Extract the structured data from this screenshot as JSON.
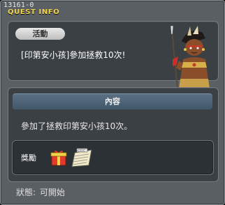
{
  "window": {
    "quest_id": "13161-0",
    "title": "QUEST INFO"
  },
  "summary": {
    "activity_badge": "活動",
    "quest_name": "[印第安小孩]參加拯救10次!"
  },
  "content": {
    "header": "內容",
    "description": "參加了拯救印第安小孩10次。",
    "reward_label": "獎勵",
    "reward_icons": [
      "gift-box-icon",
      "ticket-icon"
    ]
  },
  "status": {
    "label": "狀態:",
    "value": "可開始"
  },
  "colors": {
    "title_yellow": "#f2d44e",
    "panel_bg": "#3b4045",
    "window_bg": "#5a5f63",
    "header_blue": "#4f6476"
  }
}
